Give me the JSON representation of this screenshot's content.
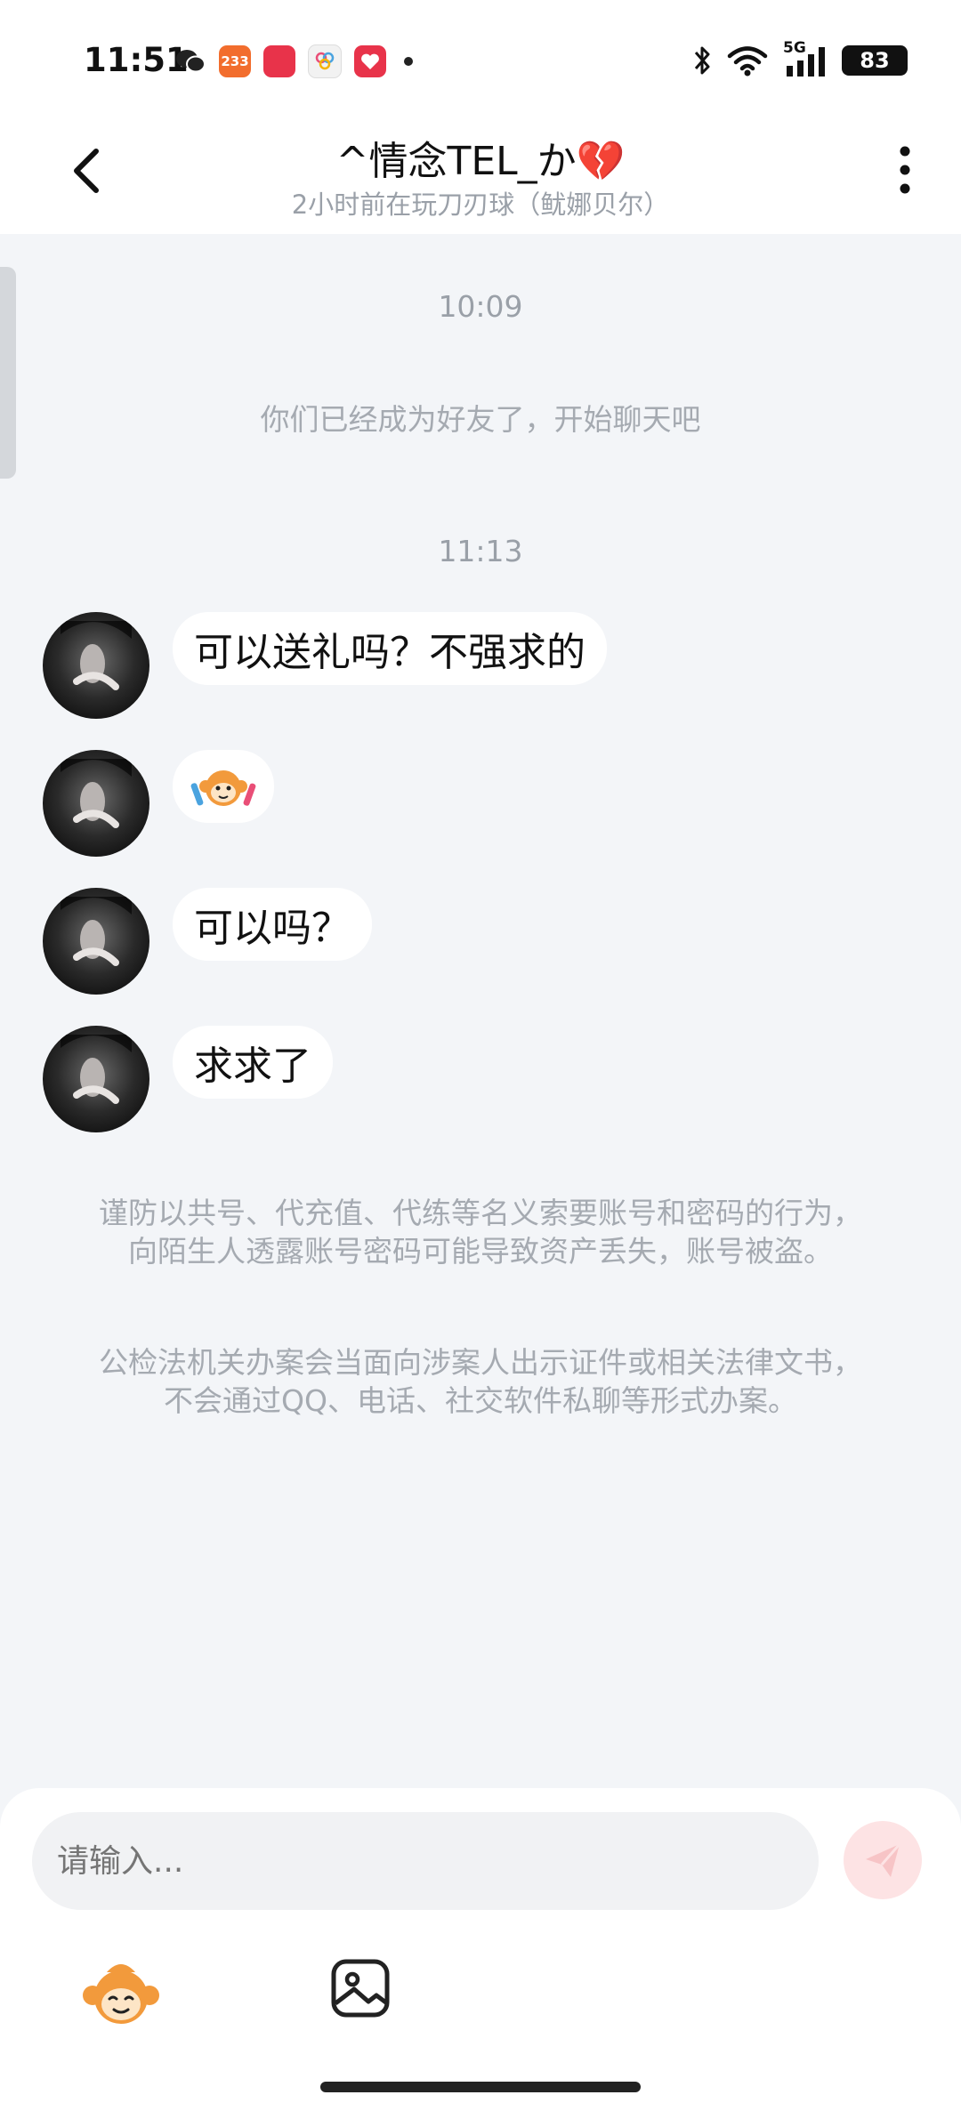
{
  "status_bar": {
    "time": "11:51",
    "apps": [
      {
        "name": "wechat-icon",
        "label": ""
      },
      {
        "name": "app-233-icon",
        "label": "233"
      },
      {
        "name": "app-red-icon",
        "label": ""
      },
      {
        "name": "app-colorful-icon",
        "label": ""
      },
      {
        "name": "app-heart-icon",
        "label": ""
      }
    ],
    "network": "5G",
    "battery": "83"
  },
  "header": {
    "title": "^情念ТEL_か💔",
    "subtitle": "2小时前在玩刀刃球（鱿娜贝尔）"
  },
  "chat": {
    "timestamp_1": "10:09",
    "system_message": "你们已经成为好友了，开始聊天吧",
    "timestamp_2": "11:13",
    "messages": [
      {
        "text": "可以送礼吗？不强求的"
      },
      {
        "text": "",
        "is_sticker": true
      },
      {
        "text": "可以吗？"
      },
      {
        "text": "求求了"
      }
    ],
    "warning_1": "谨防以共号、代充值、代练等名义索要账号和密码的行为，向陌生人透露账号密码可能导致资产丢失，账号被盗。",
    "warning_2": "公检法机关办案会当面向涉案人出示证件或相关法律文书，不会通过QQ、电话、社交软件私聊等形式办案。"
  },
  "input": {
    "placeholder": "请输入..."
  },
  "colors": {
    "background": "#f3f5f8",
    "bubble": "#ffffff",
    "send_button": "#fde3e4",
    "muted_text": "#9aa0a8"
  }
}
